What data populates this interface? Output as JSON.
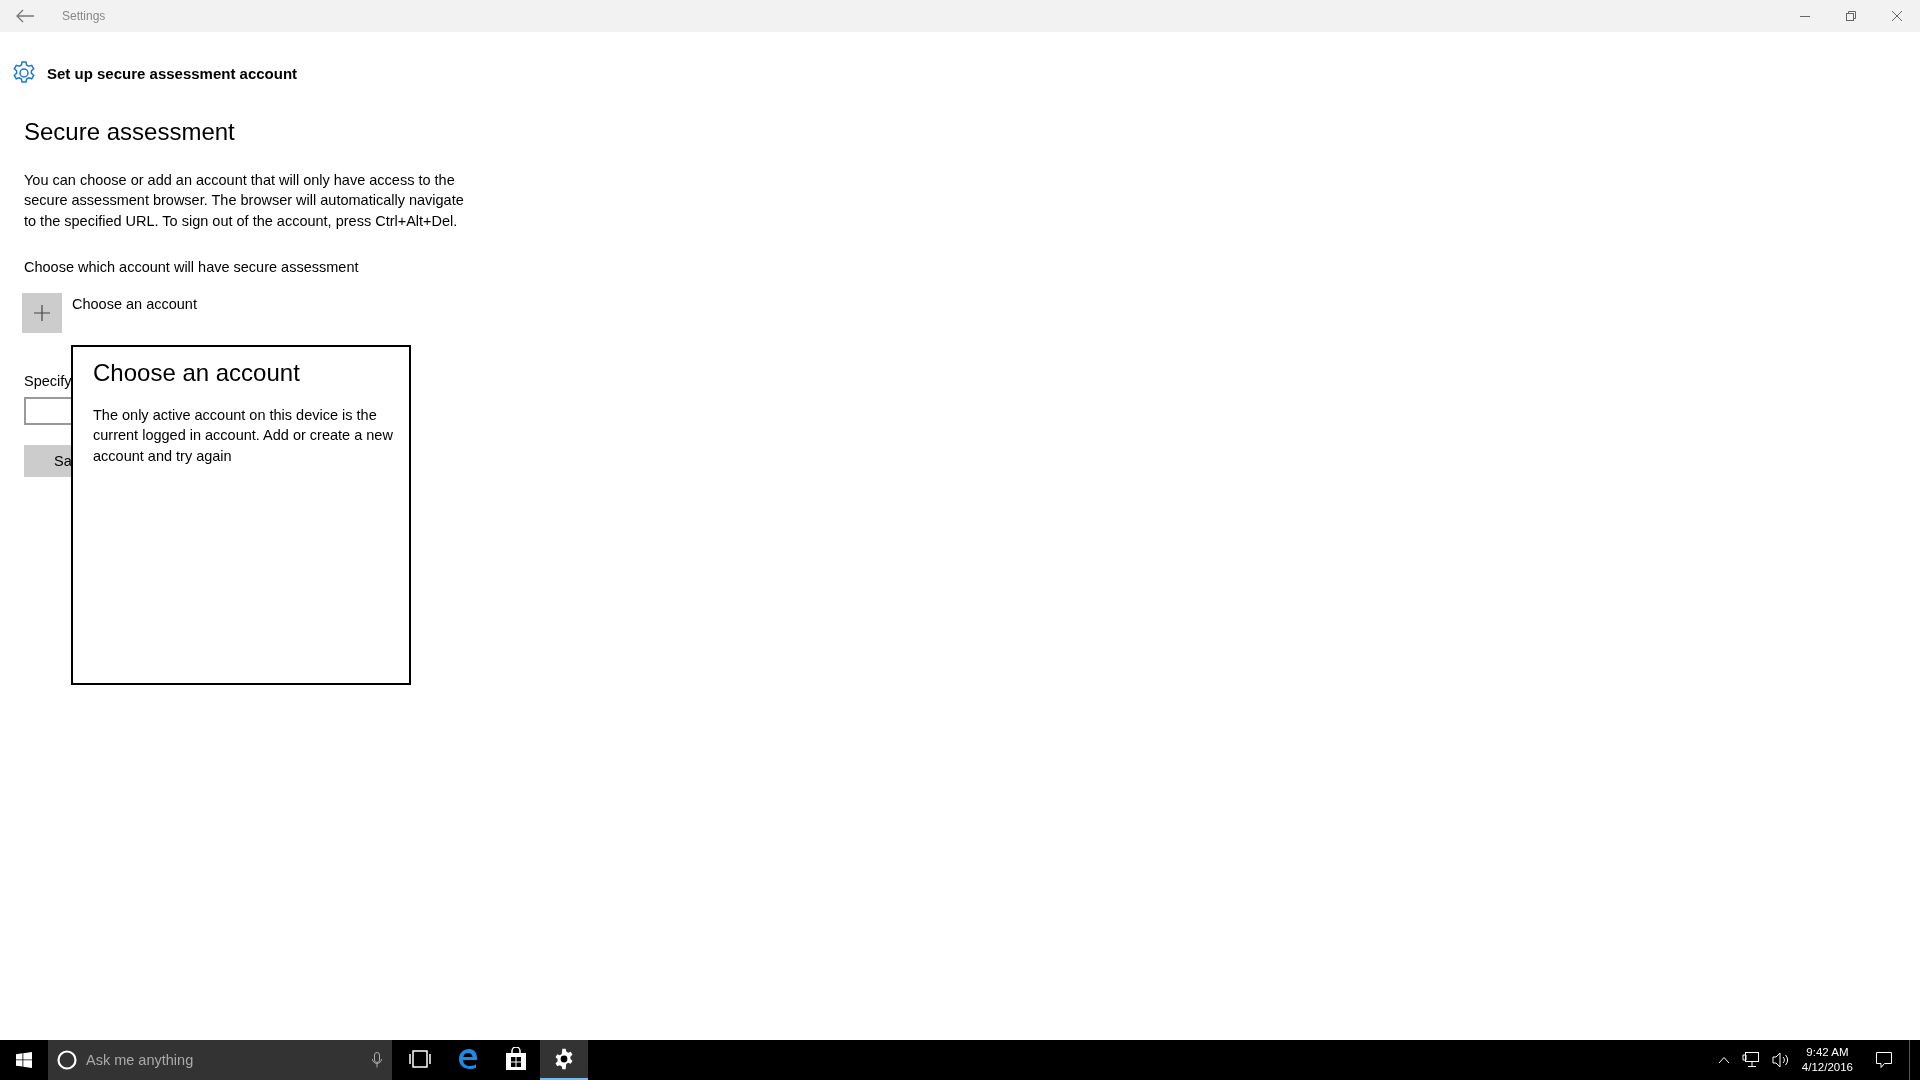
{
  "window": {
    "title": "Settings"
  },
  "page": {
    "header": "Set up secure assessment account",
    "heading": "Secure assessment",
    "description": "You can choose or add an account that will only have access to the secure assessment browser. The browser will automatically navigate to the specified URL. To sign out of the account, press Ctrl+Alt+Del.",
    "account_label": "Choose which account will have secure assessment",
    "add_account": "Choose an account",
    "url_label": "Specify",
    "save_button": "Sa"
  },
  "dialog": {
    "title": "Choose an account",
    "message": "The only active account on this device is the current logged in account. Add or create a new account and try again"
  },
  "taskbar": {
    "search": {
      "placeholder": "Ask me anything"
    },
    "apps": [
      {
        "kind": "taskview",
        "selected": false
      },
      {
        "kind": "browser",
        "selected": false
      },
      {
        "kind": "store",
        "selected": false
      },
      {
        "kind": "settings",
        "selected": true
      }
    ],
    "clock": {
      "time": "9:42 AM",
      "date": "4/12/2016"
    }
  }
}
